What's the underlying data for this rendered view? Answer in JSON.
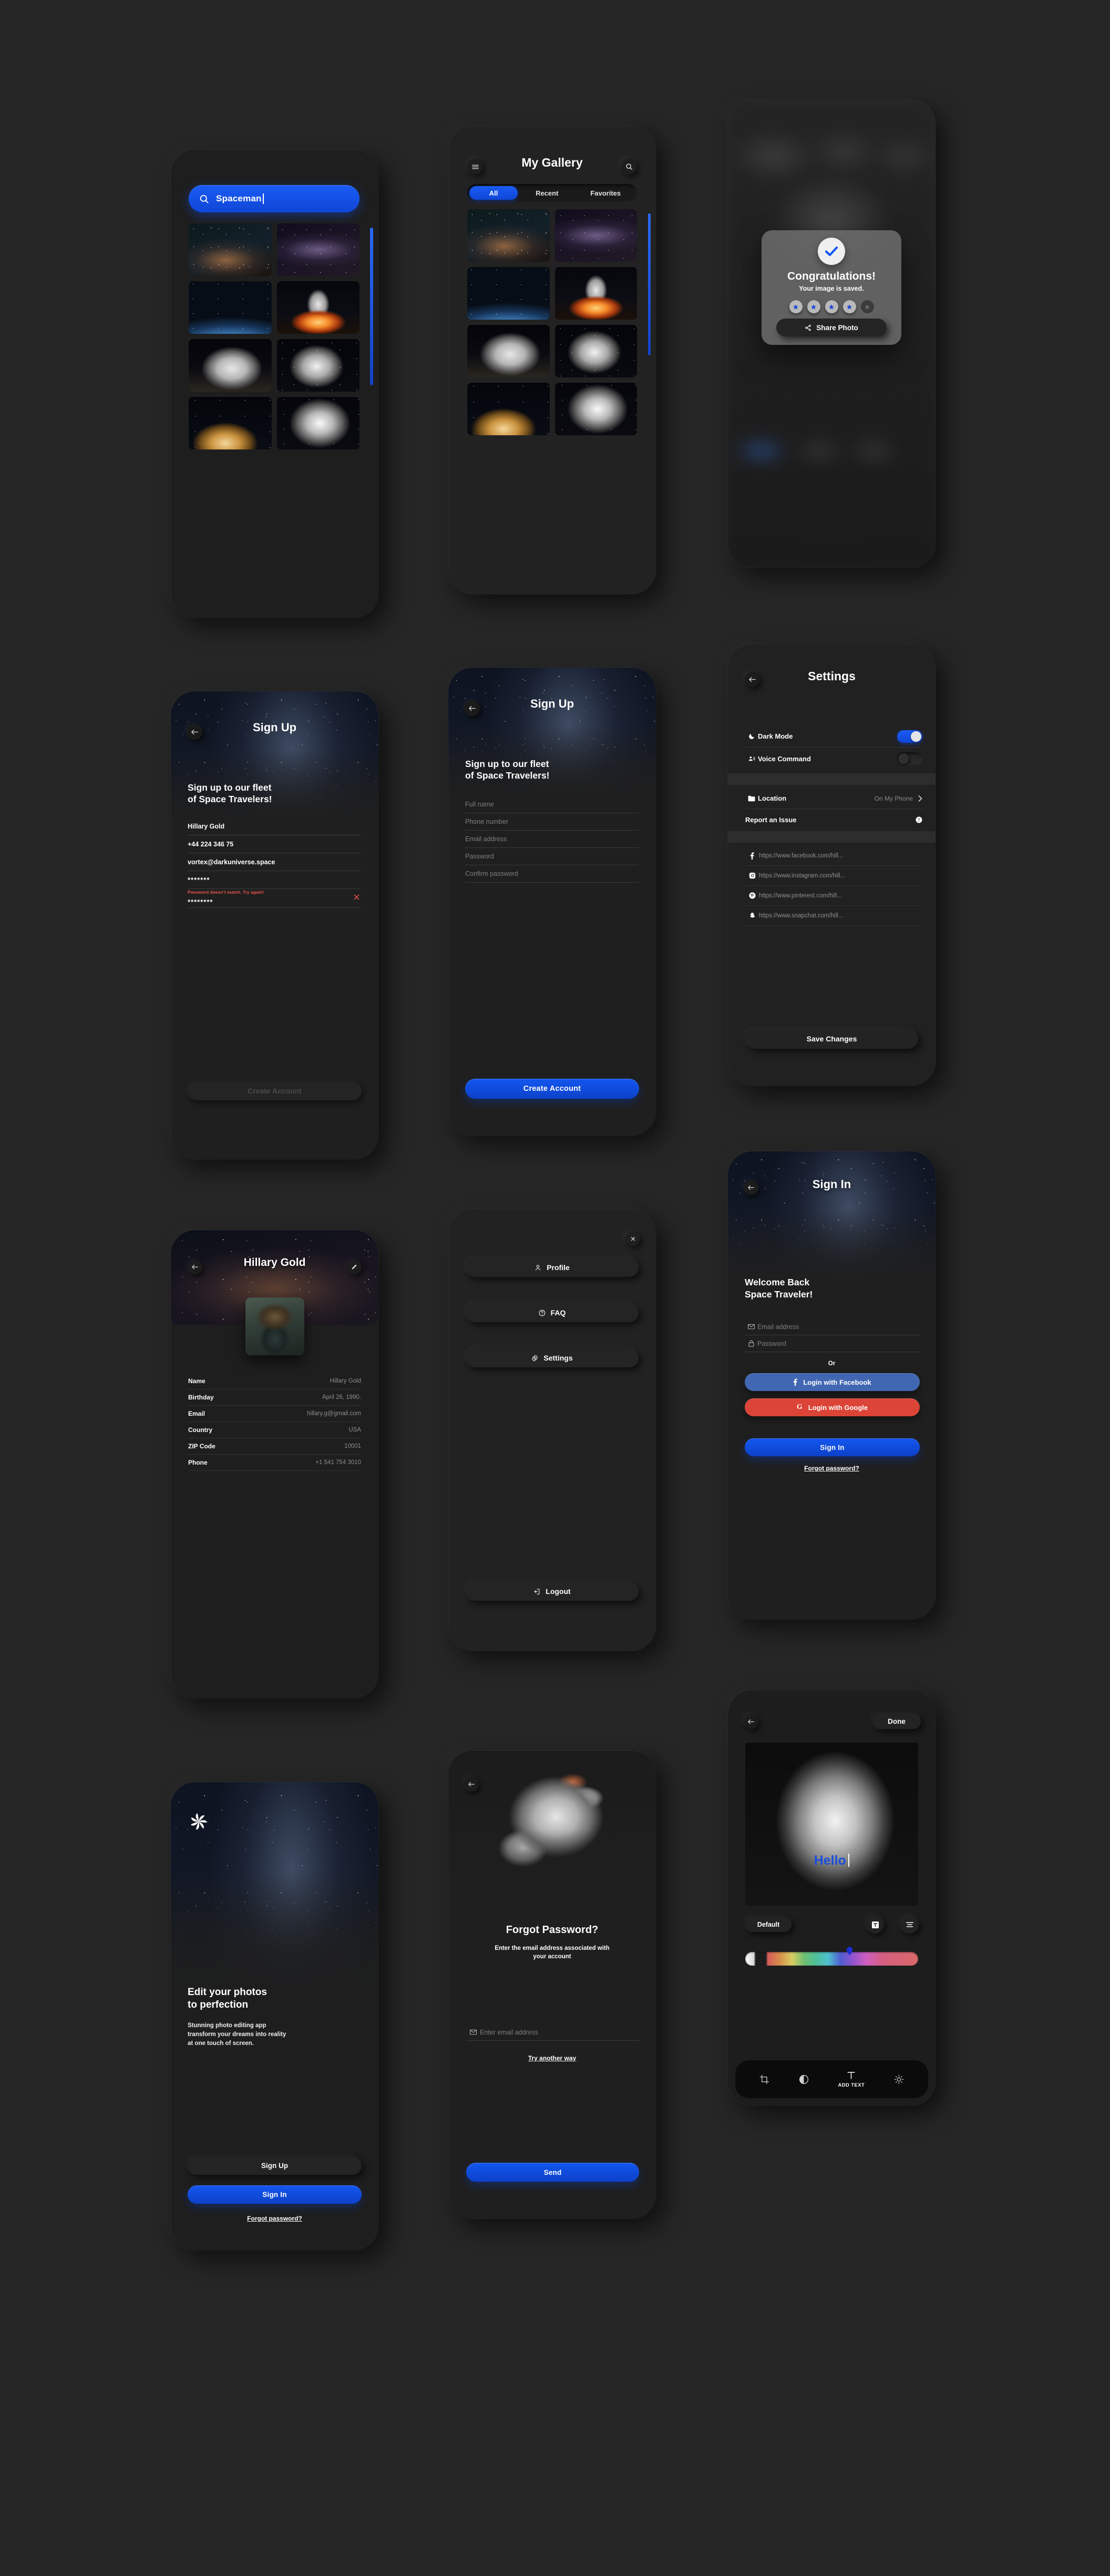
{
  "screens": {
    "search": {
      "search_value": "Spaceman",
      "search_icon": "search-icon",
      "thumbs": [
        "nebula-warm",
        "nebula-purple",
        "earth",
        "rocket",
        "astronaut-moon",
        "astronaut-space",
        "planet",
        "astronaut-suit"
      ]
    },
    "gallery": {
      "title": "My Gallery",
      "menu_icon": "hamburger-icon",
      "search_icon": "search-icon",
      "tabs": [
        {
          "label": "All",
          "active": true
        },
        {
          "label": "Recent",
          "active": false
        },
        {
          "label": "Favorites",
          "active": false
        }
      ]
    },
    "congrats": {
      "check_icon": "checkmark-icon",
      "title": "Congratulations!",
      "subtitle": "Your image is saved.",
      "rating_filled": 4,
      "rating_total": 5,
      "share_label": "Share Photo",
      "share_icon": "share-icon"
    },
    "signup_filled": {
      "header_title": "Sign Up",
      "back_icon": "back-arrow-icon",
      "heading": "Sign up to our fleet\nof Space Travelers!",
      "fields": [
        {
          "value": "Hillary Gold",
          "error": ""
        },
        {
          "value": "+44 224 346 75",
          "error": ""
        },
        {
          "value": "vortex@darkuniverse.space",
          "error": ""
        },
        {
          "value": "*******",
          "error": ""
        },
        {
          "value": "********",
          "error": "Password doesn’t match. Try again!"
        }
      ],
      "error_icon": "error-x-icon",
      "submit_label": "Create Account",
      "submit_disabled": true
    },
    "signup_empty": {
      "header_title": "Sign Up",
      "back_icon": "back-arrow-icon",
      "heading": "Sign up to our fleet\nof Space Travelers!",
      "placeholders": [
        "Full name",
        "Phone number",
        "Email address",
        "Password",
        "Confirm password"
      ],
      "submit_label": "Create Account"
    },
    "settings": {
      "title": "Settings",
      "back_icon": "back-arrow-icon",
      "toggles": [
        {
          "label": "Dark Mode",
          "icon": "moon-icon",
          "on": true
        },
        {
          "label": "Voice Command",
          "icon": "voice-icon",
          "on": false
        }
      ],
      "rows": [
        {
          "label": "Location",
          "icon": "folder-icon",
          "value": "On My Phone",
          "accessory": "chevron-right-icon"
        },
        {
          "label": "Report an Issue",
          "icon": "",
          "value": "",
          "accessory": "info-icon"
        }
      ],
      "social": [
        {
          "icon": "facebook-icon",
          "url": "https://www.facebook.com/hill..."
        },
        {
          "icon": "instagram-icon",
          "url": "https://www.instagram.com/hill..."
        },
        {
          "icon": "pinterest-icon",
          "url": "https://www.pinterest.com/hill..."
        },
        {
          "icon": "snapchat-icon",
          "url": "https://www.snapchat.com/hill..."
        }
      ],
      "save_label": "Save Changes"
    },
    "profile": {
      "name": "Hillary Gold",
      "back_icon": "back-arrow-icon",
      "edit_icon": "edit-pencil-icon",
      "rows": [
        {
          "label": "Name",
          "value": "Hillary Gold"
        },
        {
          "label": "Birthday",
          "value": "April 26, 1990."
        },
        {
          "label": "Email",
          "value": "hillary.g@gmail.com"
        },
        {
          "label": "Country",
          "value": "USA"
        },
        {
          "label": "ZIP Code",
          "value": "10001"
        },
        {
          "label": "Phone",
          "value": "+1 541 754 3010"
        }
      ]
    },
    "menu": {
      "close_icon": "close-x-icon",
      "items": [
        {
          "label": "Profile",
          "icon": "person-icon"
        },
        {
          "label": "FAQ",
          "icon": "question-circle-icon"
        },
        {
          "label": "Settings",
          "icon": "gear-icon"
        }
      ],
      "logout_label": "Logout",
      "logout_icon": "logout-icon"
    },
    "signin": {
      "header_title": "Sign In",
      "back_icon": "back-arrow-icon",
      "heading": "Welcome Back\nSpace Traveler!",
      "email_placeholder": "Email address",
      "email_icon": "envelope-icon",
      "password_placeholder": "Password",
      "password_icon": "lock-icon",
      "or_label": "Or",
      "facebook_label": "Login with Facebook",
      "facebook_icon": "facebook-icon",
      "facebook_color": "#4267B2",
      "google_label": "Login with Google",
      "google_icon": "google-g-icon",
      "google_color": "#DB4437",
      "signin_label": "Sign In",
      "forgot_label": "Forgot password?"
    },
    "onboarding": {
      "logo_icon": "spiral-logo-icon",
      "heading": "Edit your photos\nto perfection",
      "body": "Stunning photo editing app\ntransform your dreams into reality\nat one touch of screen.",
      "signup_label": "Sign Up",
      "signin_label": "Sign In",
      "forgot_label": "Forgot password?"
    },
    "forgot": {
      "back_icon": "back-arrow-icon",
      "title": "Forgot Password?",
      "subtitle": "Enter the email address associated with\nyour account",
      "email_placeholder": "Enter email address",
      "email_icon": "envelope-icon",
      "try_another_label": "Try another way",
      "send_label": "Send"
    },
    "editor": {
      "back_icon": "back-arrow-icon",
      "done_label": "Done",
      "overlay_text": "Hello",
      "overlay_color": "#1b4ddb",
      "font_label": "Default",
      "text_style_icon": "text-box-icon",
      "align_icon": "align-icon",
      "slider_handle_color": "#1a2fd6",
      "tools": [
        {
          "label": "",
          "icon": "crop-icon",
          "active": false
        },
        {
          "label": "",
          "icon": "contrast-icon",
          "active": false
        },
        {
          "label": "ADD TEXT",
          "icon": "text-t-icon",
          "active": true
        },
        {
          "label": "",
          "icon": "brightness-icon",
          "active": false
        }
      ]
    }
  },
  "theme": {
    "accent_blue": "#1357f0",
    "background": "#262626",
    "surface": "#1e1e1e",
    "error_red": "#e8534a",
    "muted_text": "#7e7e7e"
  }
}
